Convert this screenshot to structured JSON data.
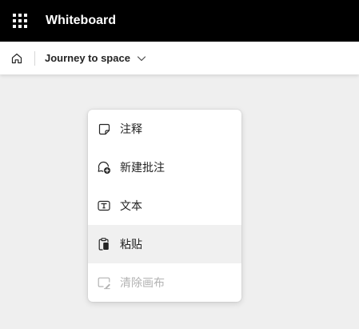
{
  "header": {
    "app_title": "Whiteboard",
    "apps_icon": "app-launcher-icon"
  },
  "subheader": {
    "home_icon": "home-icon",
    "document_title": "Journey to space",
    "dropdown_icon": "chevron-down-icon"
  },
  "context_menu": {
    "items": [
      {
        "label": "注释",
        "icon": "sticky-note-icon",
        "disabled": false
      },
      {
        "label": "新建批注",
        "icon": "add-comment-icon",
        "disabled": false
      },
      {
        "label": "文本",
        "icon": "text-box-icon",
        "disabled": false
      },
      {
        "label": "粘贴",
        "icon": "clipboard-paste-icon",
        "disabled": false,
        "highlighted": true
      },
      {
        "label": "清除画布",
        "icon": "clear-canvas-icon",
        "disabled": true
      }
    ]
  }
}
